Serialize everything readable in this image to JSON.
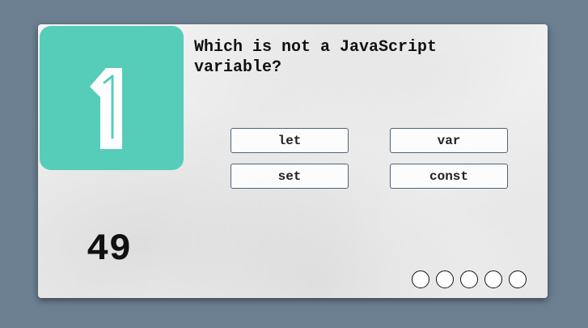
{
  "quiz": {
    "logo_icon": "number-one-icon",
    "question": "Which is not a JavaScript variable?",
    "answers": [
      "let",
      "var",
      "set",
      "const"
    ],
    "timer": "49",
    "progress": {
      "total": 5,
      "completed": 0
    }
  },
  "colors": {
    "page_background": "#6b7f91",
    "logo_tile": "#56cdb8",
    "button_border": "#4f6478"
  }
}
